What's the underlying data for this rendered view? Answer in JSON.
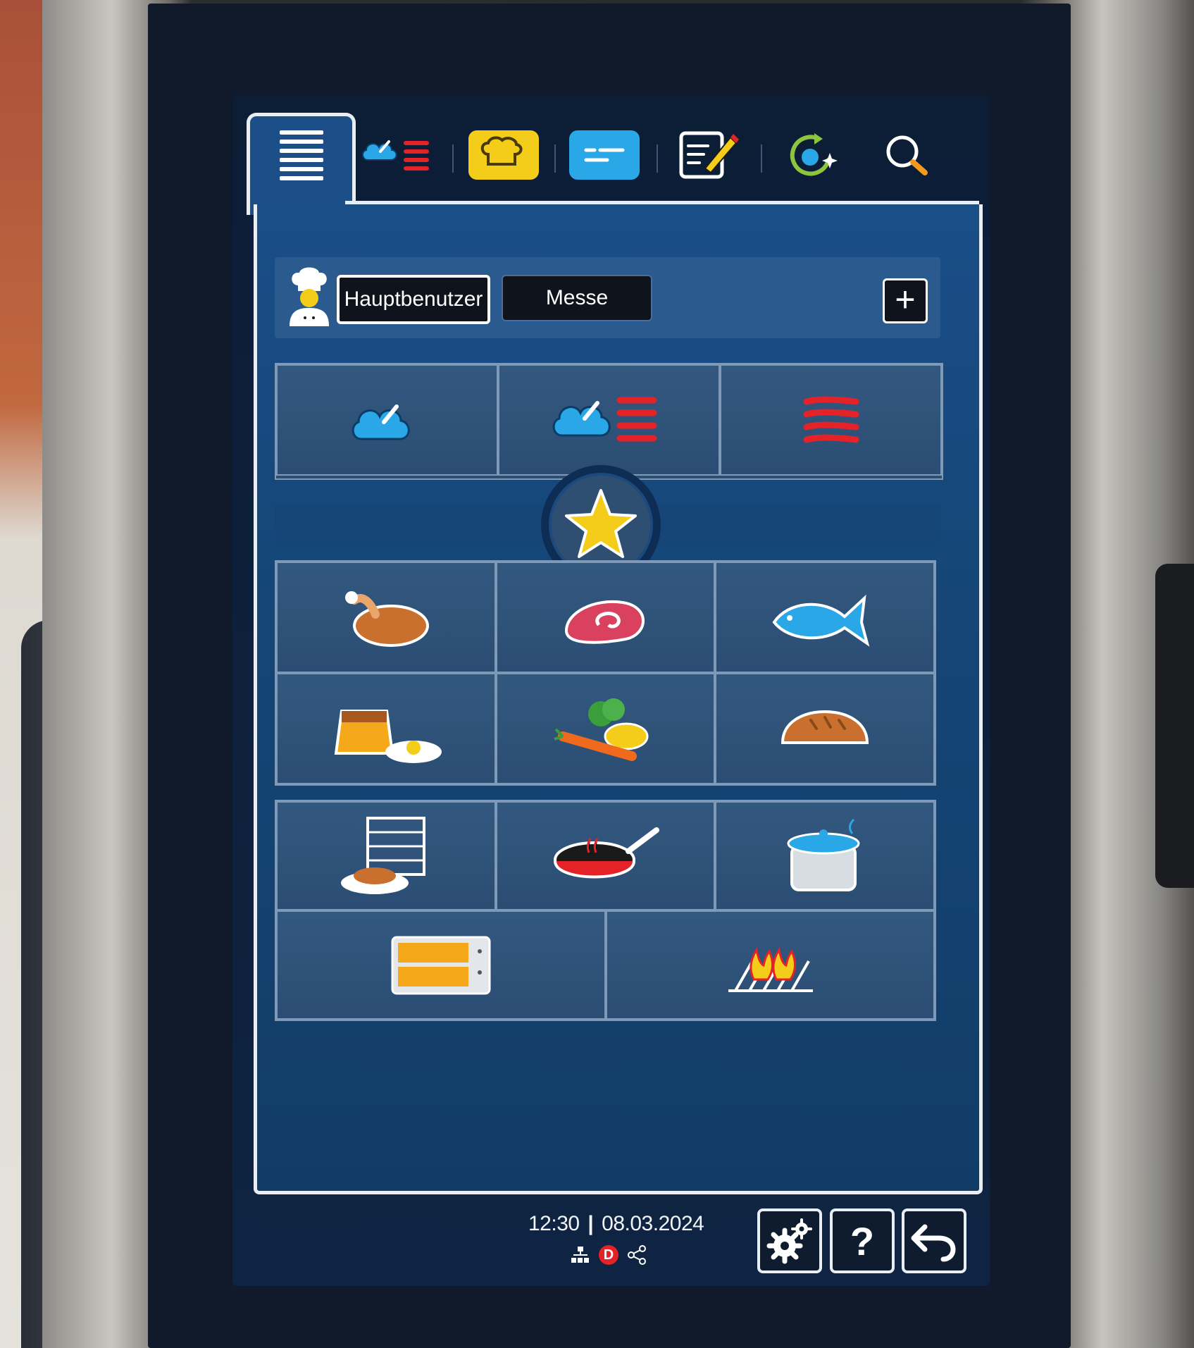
{
  "tabs": [
    {
      "name": "menu",
      "icon": "menu-lines-icon"
    },
    {
      "name": "steam-grill",
      "icon": "steam-heat-icon"
    },
    {
      "name": "bakery",
      "icon": "bread-chef-icon"
    },
    {
      "name": "programs",
      "icon": "program-list-icon"
    },
    {
      "name": "edit",
      "icon": "edit-notepad-icon"
    },
    {
      "name": "refresh",
      "icon": "sync-star-icon"
    },
    {
      "name": "search",
      "icon": "search-icon"
    }
  ],
  "userbar": {
    "chef_icon": "chef-icon",
    "users": [
      {
        "label": "Hauptbenutzer",
        "selected": true
      },
      {
        "label": "Messe",
        "selected": false
      }
    ],
    "add_label": "+"
  },
  "modes": [
    {
      "name": "steam",
      "icon": "steam-icon"
    },
    {
      "name": "combi",
      "icon": "combi-steam-heat-icon"
    },
    {
      "name": "hot-air",
      "icon": "hot-air-icon"
    }
  ],
  "favorite": {
    "icon": "star-icon"
  },
  "food_categories": [
    {
      "name": "poultry",
      "icon": "chicken-icon"
    },
    {
      "name": "meat",
      "icon": "meat-icon"
    },
    {
      "name": "fish",
      "icon": "fish-icon"
    },
    {
      "name": "eggs-desserts",
      "icon": "pudding-egg-icon"
    },
    {
      "name": "vegetables",
      "icon": "vegetables-icon"
    },
    {
      "name": "bakery",
      "icon": "bread-icon"
    }
  ],
  "special_modes": [
    {
      "name": "banquet",
      "icon": "plate-rack-icon"
    },
    {
      "name": "pan-frying",
      "icon": "pan-icon"
    },
    {
      "name": "cooking-pot",
      "icon": "pot-icon"
    },
    {
      "name": "holding",
      "icon": "oven-icon"
    },
    {
      "name": "grill",
      "icon": "grill-icon"
    }
  ],
  "footer": {
    "time": "12:30",
    "separator": "|",
    "date": "08.03.2024",
    "status_icons": [
      "network-icon",
      "d-badge-icon",
      "share-icon"
    ],
    "d_label": "D",
    "help_label": "?"
  },
  "colors": {
    "accent_blue": "#2aa7e6",
    "heat_red": "#e42228",
    "tab_yellow": "#f4cc1a",
    "panel_blue": "#164678"
  }
}
